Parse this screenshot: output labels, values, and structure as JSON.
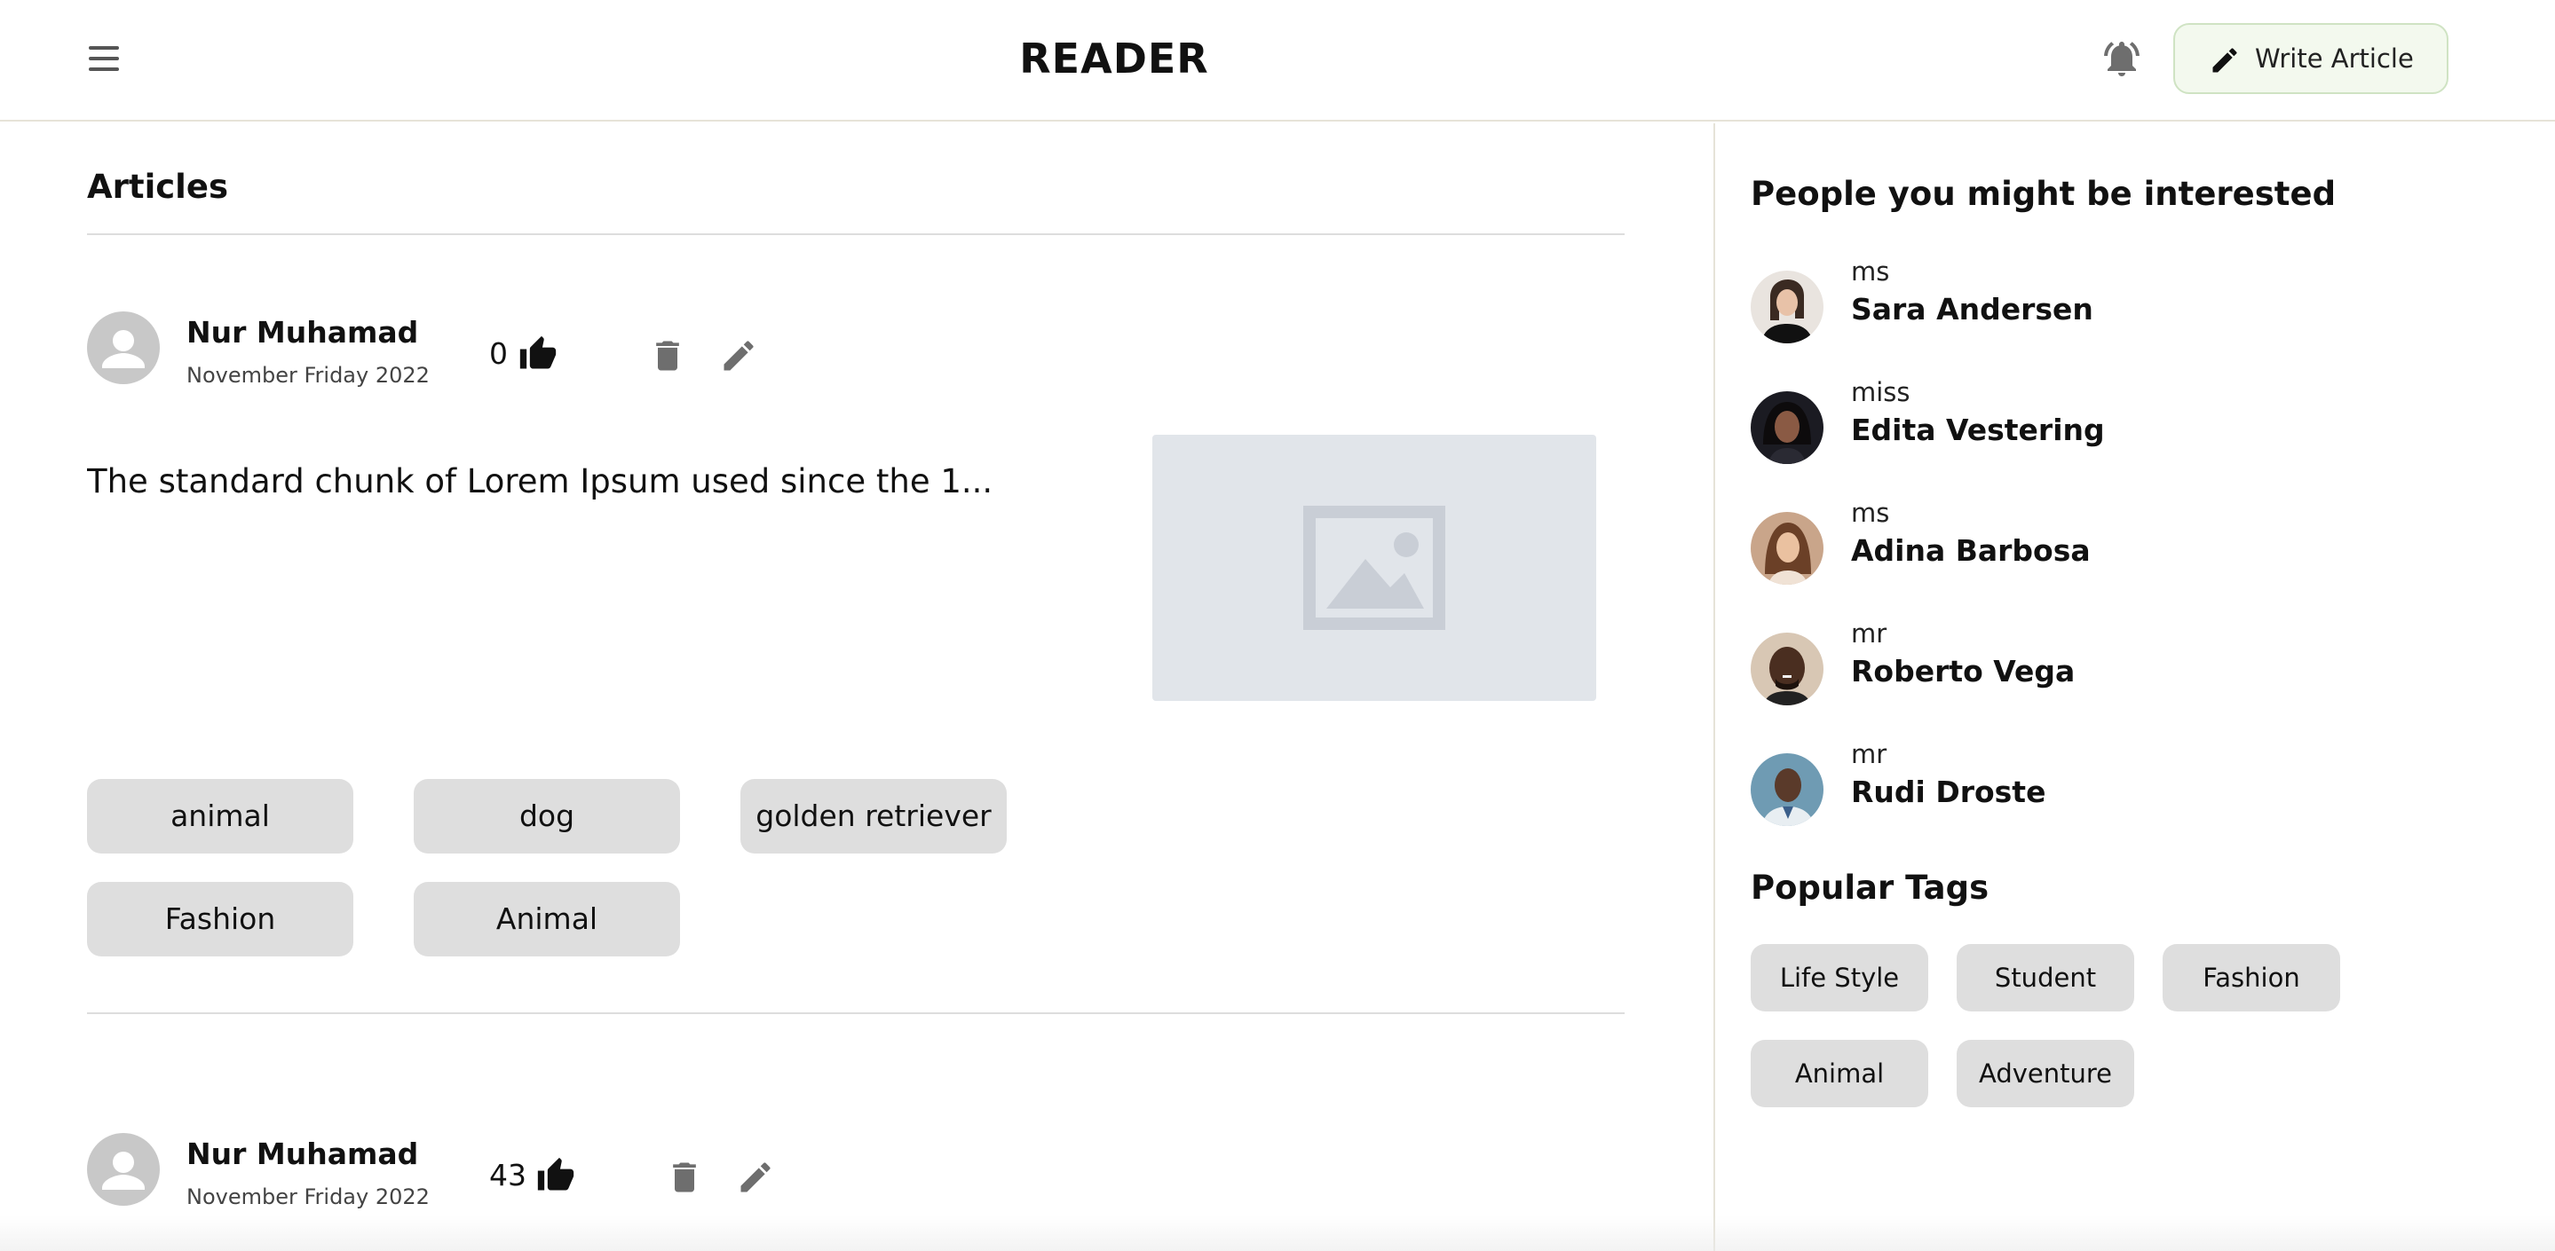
{
  "header": {
    "title": "READER",
    "menu_icon": "hamburger-menu-icon",
    "bell_icon": "notification-bell-icon",
    "write_button_label": "Write Article",
    "write_icon": "pencil-icon"
  },
  "main": {
    "heading": "Articles",
    "articles": [
      {
        "author": "Nur Muhamad",
        "date": "November Friday 2022",
        "likes": "0",
        "excerpt": "The standard chunk of Lorem Ipsum used since the 1...",
        "image": "image-placeholder-icon",
        "tags": [
          "animal",
          "dog",
          "golden retriever",
          "Fashion",
          "Animal"
        ]
      },
      {
        "author": "Nur Muhamad",
        "date": "November Friday 2022",
        "likes": "43"
      }
    ]
  },
  "sidebar": {
    "people_heading": "People you might be interested",
    "people": [
      {
        "title": "ms",
        "name": "Sara Andersen"
      },
      {
        "title": "miss",
        "name": "Edita Vestering"
      },
      {
        "title": "ms",
        "name": "Adina Barbosa"
      },
      {
        "title": "mr",
        "name": "Roberto Vega"
      },
      {
        "title": "mr",
        "name": "Rudi Droste"
      }
    ],
    "tags_heading": "Popular Tags",
    "popular_tags": [
      "Life Style",
      "Student",
      "Fashion",
      "Animal",
      "Adventure"
    ]
  },
  "colors": {
    "write_button_bg": "#f3f9ee",
    "tag_bg": "#dedede",
    "divider": "#dddddd",
    "icon_gray": "#6e6e6e"
  }
}
